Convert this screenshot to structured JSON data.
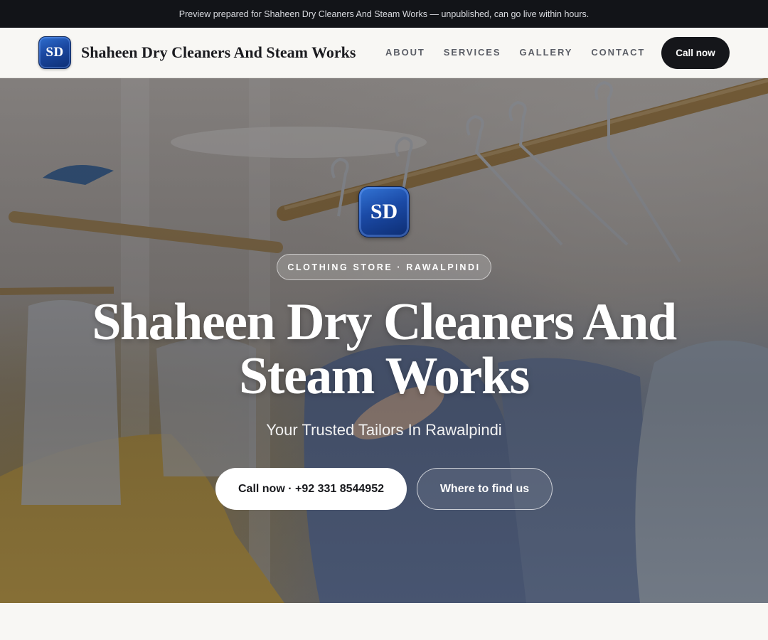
{
  "banner": {
    "text": "Preview prepared for Shaheen Dry Cleaners And Steam Works — unpublished, can go live within hours."
  },
  "header": {
    "logo_initials": "SD",
    "brand_name": "Shaheen Dry Cleaners And Steam Works",
    "nav": [
      {
        "label": "ABOUT"
      },
      {
        "label": "SERVICES"
      },
      {
        "label": "GALLERY"
      },
      {
        "label": "CONTACT"
      }
    ],
    "cta_label": "Call now"
  },
  "hero": {
    "logo_initials": "SD",
    "category": "CLOTHING STORE · RAWALPINDI",
    "title_line1": "Shaheen Dry Cleaners And",
    "title_line2": "Steam Works",
    "subtitle": "Your Trusted Tailors In Rawalpindi",
    "primary_button": "Call now · +92 331 8544952",
    "secondary_button": "Where to find us",
    "background_image": "clothes-on-hangers-photo"
  },
  "colors": {
    "banner_bg": "#121418",
    "dark_button": "#15161a",
    "logo_blue": "#1b4aa6",
    "page_bg": "#f8f7f4"
  }
}
